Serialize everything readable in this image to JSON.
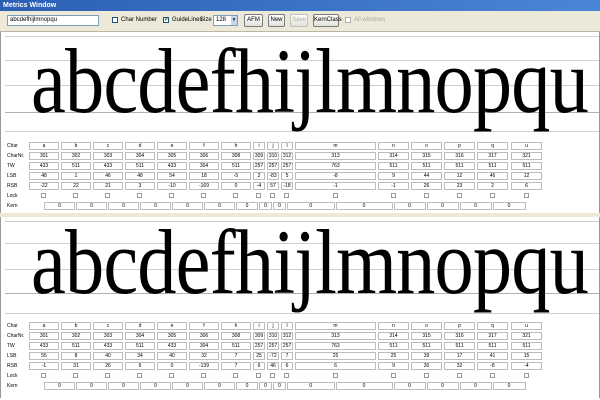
{
  "window": {
    "title": "Metrics Window"
  },
  "toolbar": {
    "text_value": "abcdefhijlmnopqu",
    "char_number_label": "Char Number",
    "char_number_checked": false,
    "guidelines_label": "GuideLines",
    "guidelines_checked": true,
    "size_label": "Size",
    "size_value": "128",
    "afm_label": "AFM",
    "new_label": "New",
    "save_label": "Save",
    "kernclass_label": "KernClass",
    "all_windows_label": "All windows",
    "all_windows_checked": false
  },
  "specimen_text": "abcdefhijlmnopqu",
  "row_labels": {
    "char": "Char",
    "charnr": "CharNr.",
    "tw": "TW",
    "lsb": "LSB",
    "rsb": "RSB",
    "lock": "Lock",
    "kern": "Kern"
  },
  "panels": [
    {
      "chars": [
        "a",
        "b",
        "c",
        "d",
        "e",
        "f",
        "h",
        "i",
        "j",
        "l",
        "m",
        "n",
        "o",
        "p",
        "q",
        "u"
      ],
      "charnr": [
        "301",
        "302",
        "303",
        "304",
        "305",
        "306",
        "308",
        "309",
        "310",
        "312",
        "313",
        "314",
        "315",
        "316",
        "317",
        "321"
      ],
      "tw": [
        "433",
        "511",
        "433",
        "511",
        "433",
        "304",
        "511",
        "257",
        "257",
        "257",
        "763",
        "511",
        "511",
        "511",
        "511",
        "511"
      ],
      "lsb": [
        "48",
        "1",
        "46",
        "48",
        "54",
        "18",
        "-5",
        "2",
        "-83",
        "5",
        "-8",
        "9",
        "44",
        "12",
        "46",
        "12"
      ],
      "rsb": [
        "-22",
        "22",
        "21",
        "3",
        "-10",
        "-169",
        "0",
        "-4",
        "57",
        "-18",
        "-1",
        "-1",
        "26",
        "23",
        "2",
        "6"
      ],
      "kern": [
        "0",
        "0",
        "0",
        "0",
        "0",
        "0",
        "0",
        "0",
        "0",
        "0",
        "0",
        "0",
        "0",
        "0",
        "0"
      ]
    },
    {
      "chars": [
        "a",
        "b",
        "c",
        "d",
        "e",
        "f",
        "h",
        "i",
        "j",
        "l",
        "m",
        "n",
        "o",
        "p",
        "q",
        "u"
      ],
      "charnr": [
        "301",
        "302",
        "303",
        "304",
        "305",
        "306",
        "308",
        "309",
        "310",
        "312",
        "313",
        "314",
        "315",
        "316",
        "317",
        "321"
      ],
      "tw": [
        "433",
        "511",
        "433",
        "511",
        "433",
        "304",
        "511",
        "257",
        "257",
        "257",
        "763",
        "511",
        "511",
        "511",
        "511",
        "511"
      ],
      "lsb": [
        "55",
        "8",
        "40",
        "34",
        "40",
        "32",
        "7",
        "25",
        "-72",
        "7",
        "25",
        "25",
        "39",
        "17",
        "41",
        "15"
      ],
      "rsb": [
        "-1",
        "31",
        "26",
        "6",
        "0",
        "-139",
        "7",
        "6",
        "46",
        "6",
        "6",
        "9",
        "30",
        "32",
        "-8",
        "-4"
      ],
      "kern": [
        "0",
        "0",
        "0",
        "0",
        "0",
        "0",
        "0",
        "0",
        "0",
        "0",
        "0",
        "0",
        "0",
        "0",
        "0"
      ]
    }
  ]
}
